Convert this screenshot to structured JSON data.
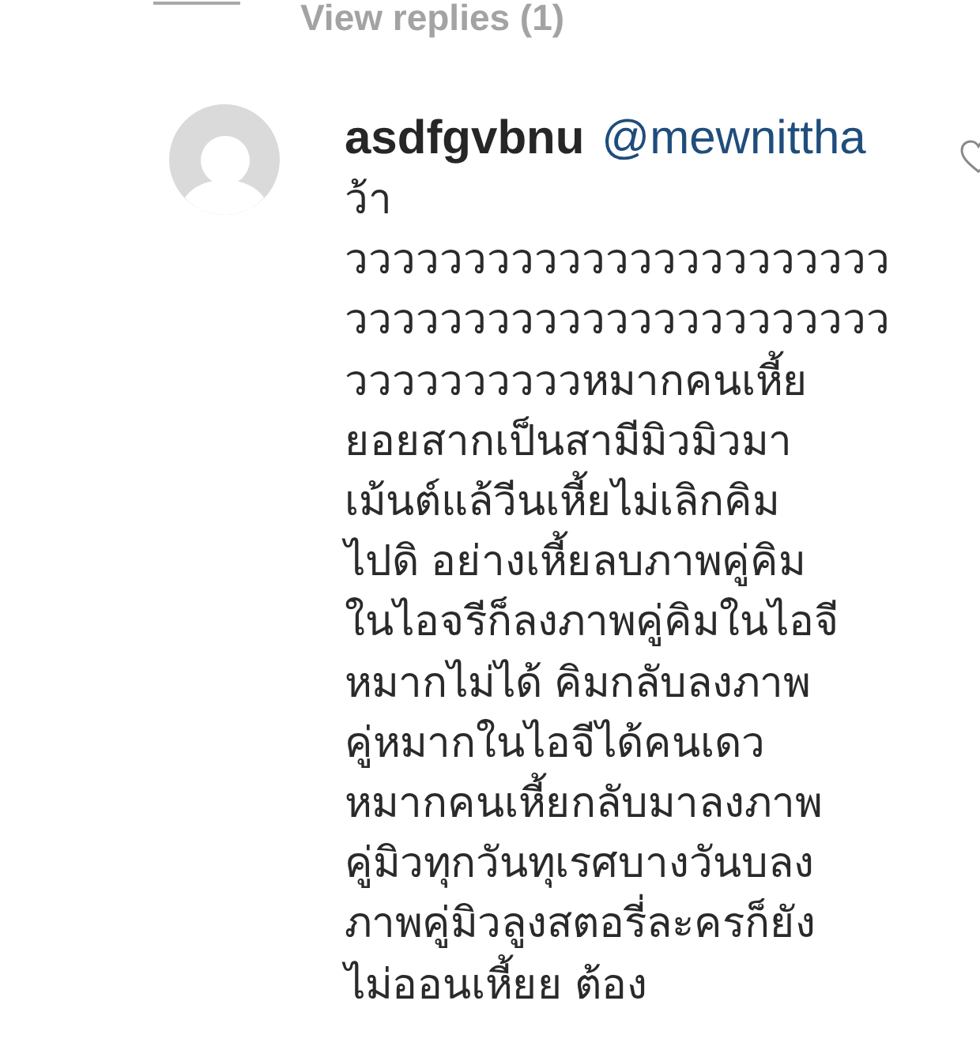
{
  "replies_toggle": {
    "label": "View replies (1)"
  },
  "comment": {
    "username": "asdfgvbnu",
    "mention": "@mewnittha",
    "liked": false,
    "text_lines": [
      "ว้า",
      "ววววววววววววววววววววววว",
      "ววววววววววววววววววววววว",
      "ววววววววววหมากคนเหี้ย",
      "ยอยสากเป็นสามีมิวมิวมา",
      "เม้นต์แล้วีนเหี้ยไม่เลิกคิม",
      "ไปดิ อย่างเหี้ยลบภาพคู่คิม",
      "ในไอจรีก็ลงภาพคู่คิมในไอจี",
      "หมากไม่ได้ คิมกลับลงภาพ",
      "คู่หมากในไอจีได้คนเดว",
      "หมากคนเหี้ยกลับมาลงภาพ",
      "คู่มิวทุกวันทุเรศบางวันบลง",
      "ภาพคู่มิวลูงสตอรี่ละครก็ยัง",
      "ไม่ออนเหี้ยย ต้อง"
    ]
  }
}
